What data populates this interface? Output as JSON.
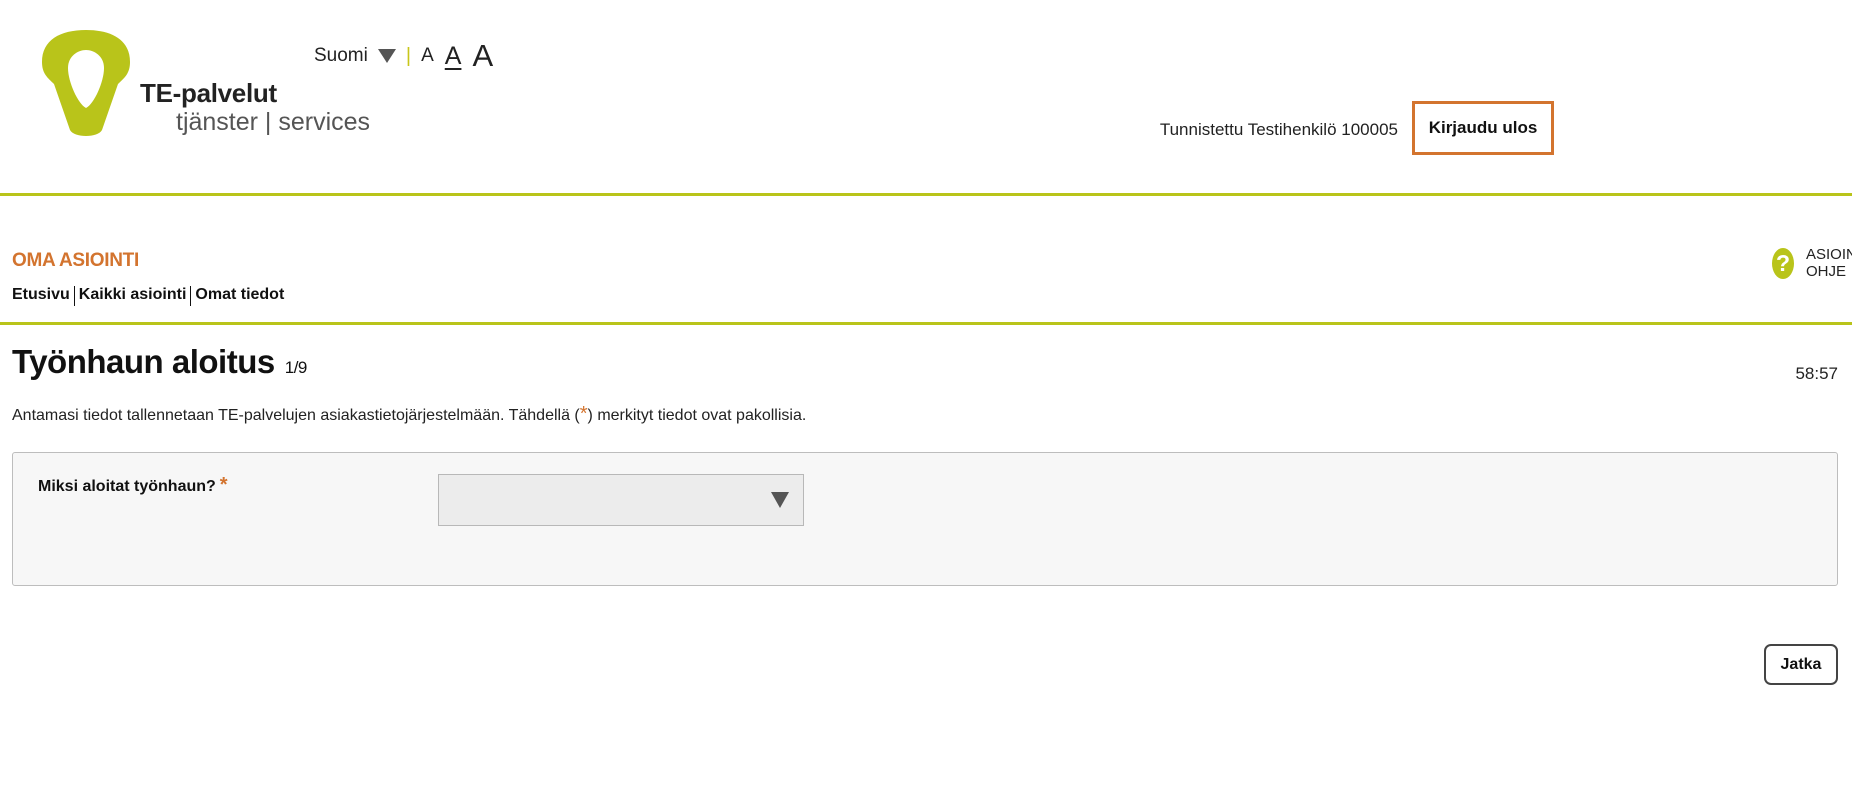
{
  "header": {
    "brand_name": "TE-palvelut",
    "brand_sub": "tjänster | services",
    "language": "Suomi",
    "font_sizes": [
      "A",
      "A",
      "A"
    ],
    "identified_user": "Tunnistettu Testihenkilö 100005",
    "logout_label": "Kirjaudu ulos"
  },
  "section": {
    "title": "OMA ASIOINTI",
    "help_label": "ASIOINNIN OHJE",
    "help_icon": "?"
  },
  "nav": {
    "items": [
      "Etusivu",
      "Kaikki asiointi",
      "Omat tiedot"
    ]
  },
  "page": {
    "title": "Työnhaun aloitus",
    "step": "1/9",
    "timer": "58:57",
    "info_before": "Antamasi tiedot tallennetaan TE-palvelujen asiakastietojärjestelmään. Tähdellä (",
    "info_asterisk": "*",
    "info_after": ") merkityt tiedot ovat pakollisia."
  },
  "form": {
    "question": "Miksi aloitat työnhaun?",
    "required_mark": "*",
    "select_value": ""
  },
  "actions": {
    "next_label": "Jatka"
  },
  "colors": {
    "accent_green": "#b9c41a",
    "accent_orange": "#d3742f"
  }
}
